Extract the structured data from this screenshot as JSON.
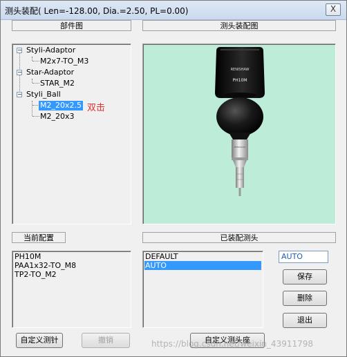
{
  "window": {
    "title": "测头装配( Len=-128.00, Dia.=2.50, PL=0.00)",
    "close_glyph": "X"
  },
  "parts_panel": {
    "label": "部件图",
    "tree": [
      {
        "label": "Styli-Adaptor",
        "children": [
          "M2x7-TO_M3"
        ]
      },
      {
        "label": "Star-Adaptor",
        "children": [
          "STAR_M2"
        ]
      },
      {
        "label": "Styli_Ball",
        "children": [
          "M2_20x2.5",
          "M2_20x3"
        ]
      }
    ],
    "selected": "M2_20x2.5",
    "annotation": "双击"
  },
  "probe_view": {
    "label": "测头装配图",
    "brand_text": "RENISHAW",
    "model_text": "PH10M",
    "colors": {
      "background": "#bdecd8",
      "body": "#111111",
      "stylus": "#c8c8c8"
    }
  },
  "current_config": {
    "label": "当前配置",
    "items": [
      "PH10M",
      "PAA1x32-TO_M8",
      "TP2-TO_M2"
    ]
  },
  "assembled_probes": {
    "label": "已装配测头",
    "items": [
      "DEFAULT",
      "AUTO"
    ],
    "selected": "AUTO"
  },
  "name_field": {
    "value": "AUTO"
  },
  "buttons": {
    "save": "保存",
    "delete": "删除",
    "exit": "退出",
    "custom_stylus": "自定义测针",
    "undo": "撤销",
    "custom_probe_base": "自定义测头座"
  },
  "watermark": "https://blog.csdn.net/weixin_43911798"
}
